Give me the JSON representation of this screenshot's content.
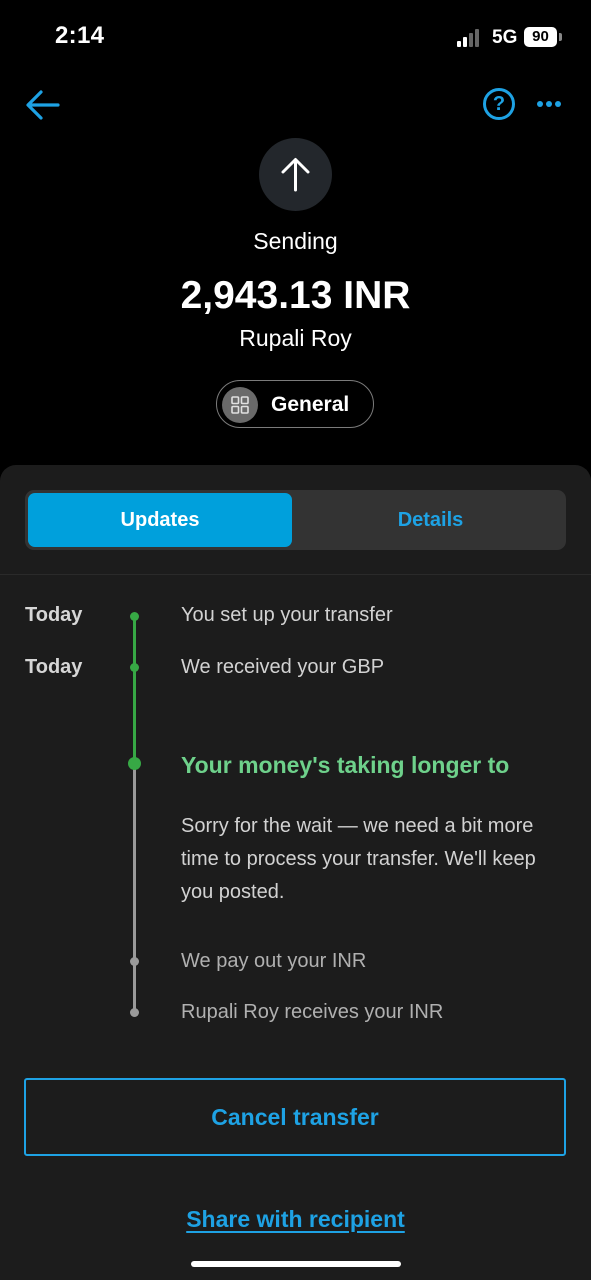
{
  "status_bar": {
    "time": "2:14",
    "network": "5G",
    "battery": "90"
  },
  "nav": {
    "back_icon": "arrow-left-icon",
    "help_icon": "question-circle-icon",
    "help_glyph": "?",
    "more_icon": "ellipsis-icon"
  },
  "header": {
    "icon": "arrow-up-icon",
    "status": "Sending",
    "amount": "2,943.13 INR",
    "recipient": "Rupali Roy",
    "category": "General",
    "category_icon": "grid-icon"
  },
  "tabs": [
    {
      "label": "Updates",
      "active": true
    },
    {
      "label": "Details",
      "active": false
    }
  ],
  "timeline": {
    "items": [
      {
        "date": "Today",
        "text": "You set up your transfer",
        "state": "done"
      },
      {
        "date": "Today",
        "text": "We received your GBP",
        "state": "done"
      },
      {
        "date": "",
        "text": "Your money's taking longer to",
        "state": "current",
        "body": "Sorry for the wait — we need a bit more time to process your transfer. We'll keep you posted."
      },
      {
        "date": "",
        "text": "We pay out your INR",
        "state": "pending"
      },
      {
        "date": "",
        "text": "Rupali Roy receives your INR",
        "state": "pending"
      }
    ]
  },
  "actions": {
    "cancel": "Cancel transfer",
    "share": "Share with recipient"
  },
  "colors": {
    "accent": "#1EA2E4",
    "tab_active": "#00A0DC",
    "success": "#37A845",
    "success_text": "#6ED18B"
  }
}
